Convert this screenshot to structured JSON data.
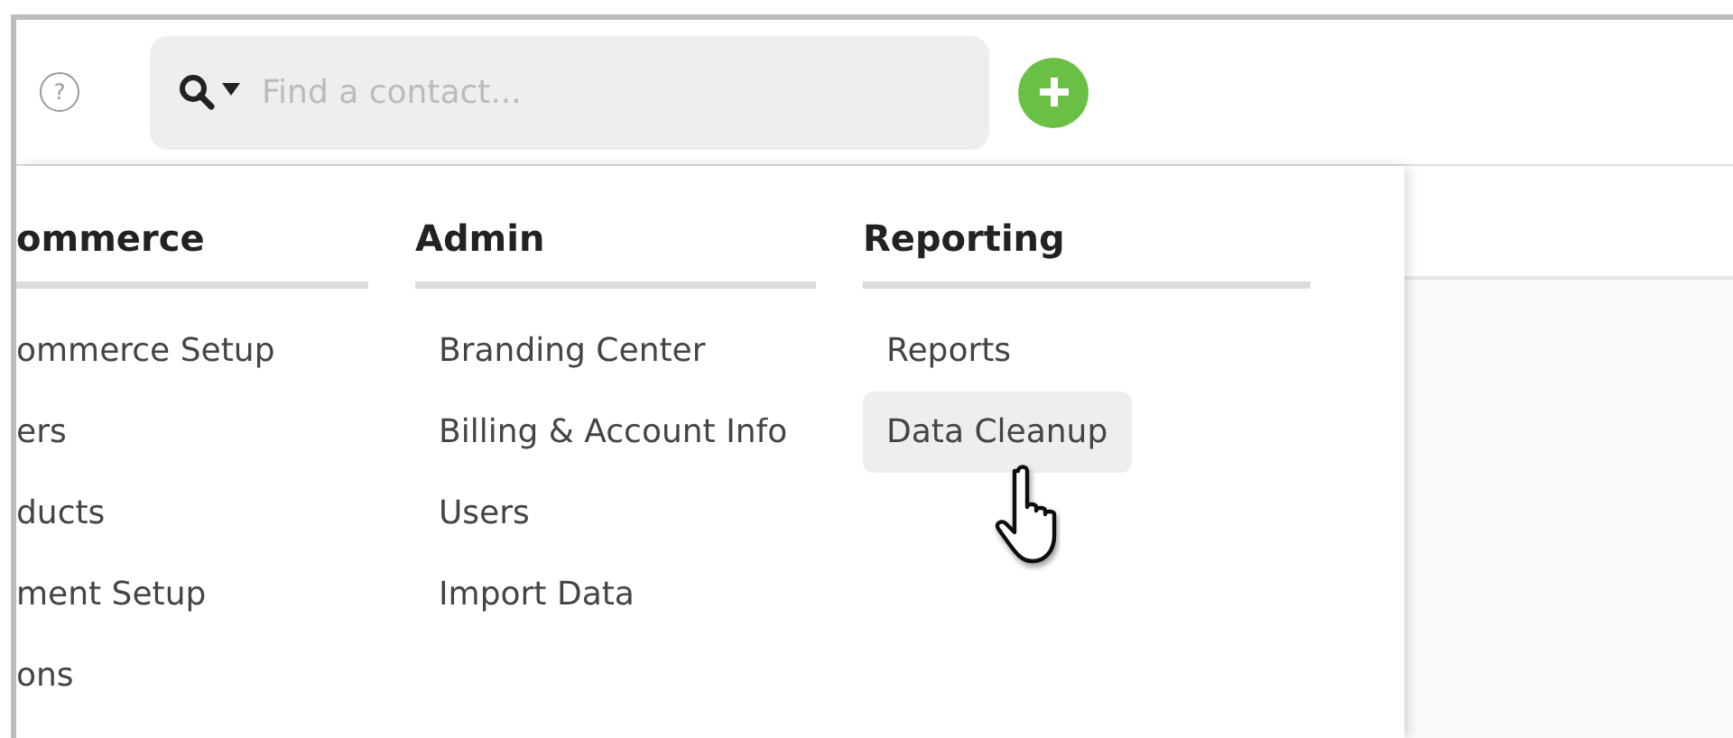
{
  "header": {
    "help_icon": "?",
    "search": {
      "placeholder": "Find a contact..."
    }
  },
  "menu": {
    "columns": [
      {
        "heading": "ommerce",
        "items": [
          {
            "label": "ommerce Setup",
            "selected": false
          },
          {
            "label": "ers",
            "selected": false
          },
          {
            "label": "ducts",
            "selected": false
          },
          {
            "label": "ment Setup",
            "selected": false
          },
          {
            "label": "ons",
            "selected": false
          }
        ]
      },
      {
        "heading": "Admin",
        "items": [
          {
            "label": "Branding Center",
            "selected": false
          },
          {
            "label": "Billing & Account Info",
            "selected": false
          },
          {
            "label": "Users",
            "selected": false
          },
          {
            "label": "Import Data",
            "selected": false
          }
        ]
      },
      {
        "heading": "Reporting",
        "items": [
          {
            "label": "Reports",
            "selected": false
          },
          {
            "label": "Data Cleanup",
            "selected": true
          }
        ]
      }
    ]
  }
}
